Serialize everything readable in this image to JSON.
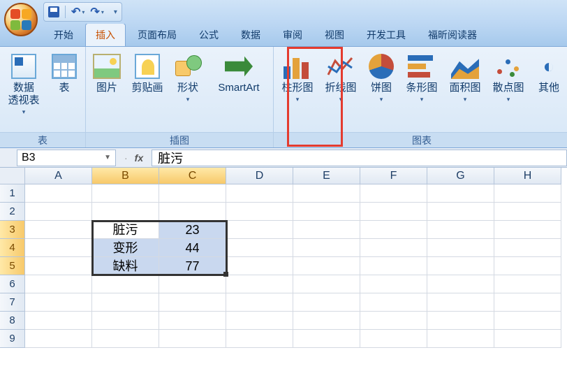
{
  "qat": {
    "menu_caret": "▾",
    "end_caret": "▾"
  },
  "tabs": {
    "home": "开始",
    "insert": "插入",
    "layout": "页面布局",
    "formulas": "公式",
    "data": "数据",
    "review": "审阅",
    "view": "视图",
    "developer": "开发工具",
    "foxit": "福昕阅读器"
  },
  "ribbon": {
    "groups": {
      "tables": "表",
      "illustrations": "插图",
      "charts": "图表"
    },
    "buttons": {
      "pivot": "数据\n透视表",
      "table": "表",
      "picture": "图片",
      "clipart": "剪贴画",
      "shapes": "形状",
      "smartart": "SmartArt",
      "column": "柱形图",
      "line": "折线图",
      "pie": "饼图",
      "barh": "条形图",
      "area": "面积图",
      "scatter": "散点图",
      "other": "其他"
    },
    "caret": "▾"
  },
  "formula": {
    "name_box": "B3",
    "fx": "fx",
    "value": "脏污",
    "btn_cancel": "✕",
    "btn_ok": "✓"
  },
  "grid": {
    "cols": [
      "A",
      "B",
      "C",
      "D",
      "E",
      "F",
      "G",
      "H"
    ],
    "rows": [
      "1",
      "2",
      "3",
      "4",
      "5",
      "6",
      "7",
      "8",
      "9"
    ],
    "data": {
      "B3": "脏污",
      "C3": "23",
      "B4": "变形",
      "C4": "44",
      "B5": "缺料",
      "C5": "77"
    }
  },
  "chart_data": {
    "type": "table",
    "categories": [
      "脏污",
      "变形",
      "缺料"
    ],
    "values": [
      23,
      44,
      77
    ]
  }
}
